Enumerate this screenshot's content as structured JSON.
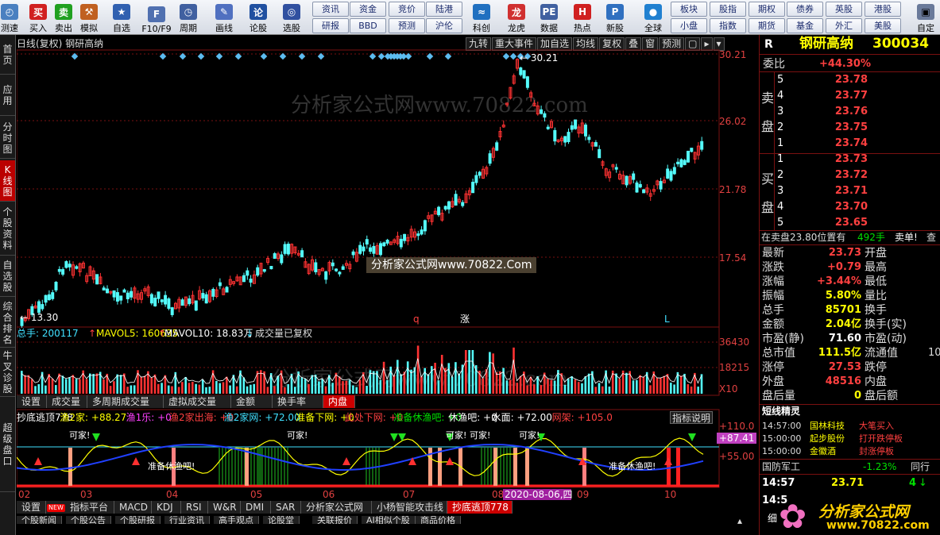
{
  "toolbar": {
    "left": [
      {
        "label": "测速",
        "icon": "speed-icon"
      },
      {
        "label": "买入",
        "icon": "buy-icon"
      },
      {
        "label": "卖出",
        "icon": "sell-icon"
      },
      {
        "label": "模拟",
        "icon": "simulate-icon"
      },
      {
        "label": "自选",
        "icon": "watchlist-icon"
      },
      {
        "label": "F10/F9",
        "icon": "f10-icon"
      },
      {
        "label": "周期",
        "icon": "clock-icon"
      },
      {
        "label": "画线",
        "icon": "pen-icon"
      },
      {
        "label": "论股",
        "icon": "forum-icon"
      },
      {
        "label": "选股",
        "icon": "select-icon"
      }
    ],
    "small": [
      [
        "资讯",
        "研报"
      ],
      [
        "资金",
        "BBD"
      ],
      [
        "竞价",
        "预测"
      ],
      [
        "陆港",
        "沪伦"
      ]
    ],
    "right": [
      {
        "label": "科创",
        "icon": "sci-icon"
      },
      {
        "label": "龙虎",
        "icon": "dragon-icon"
      },
      {
        "label": "数据",
        "icon": "data-icon"
      },
      {
        "label": "热点",
        "icon": "hot-icon"
      },
      {
        "label": "新股",
        "icon": "ipo-icon"
      },
      {
        "label": "全球",
        "icon": "globe-icon"
      }
    ],
    "small2": [
      [
        "板块",
        "小盘"
      ],
      [
        "股指",
        "指数"
      ],
      [
        "期权",
        "期货"
      ],
      [
        "债券",
        "基金"
      ],
      [
        "英股",
        "外汇"
      ],
      [
        "港股",
        "美股"
      ]
    ],
    "custom": "自定"
  },
  "sidebar": [
    "首页",
    "应用",
    "分时图",
    "K线图",
    "个股资料",
    "自选股",
    "综合排名",
    "牛叉诊股",
    "超级盘口"
  ],
  "chart": {
    "title": "日线(复权) 钢研高纳",
    "buttons": [
      "九转",
      "重大事件",
      "加自选",
      "均线",
      "复权",
      "叠",
      "窗",
      "预测"
    ],
    "price_axis": [
      "30.21",
      "26.02",
      "21.78",
      "17.54"
    ],
    "high_label": "30.21",
    "low_label": "13.30",
    "watermark": "分析家公式网www.70822.com",
    "watermark2": "分析家公式网www.70822.Com",
    "markers": [
      "q",
      "涨",
      "L"
    ],
    "vol_header": {
      "total": "总手: 200117",
      "ma5": "MAVOL5: 160635",
      "ma10": "MAVOL10: 18.83万",
      "note": "成交量已复权"
    },
    "vol_axis": [
      "36430",
      "18215",
      "X10"
    ],
    "vol_tabs": [
      "设置",
      "成交量",
      "多周期成交量",
      "虚拟成交量",
      "金额",
      "换手率",
      "内盘"
    ],
    "ind_header": [
      [
        "抄底逃顶778",
        "wht"
      ],
      [
        "渔2家: +88.27",
        "yel"
      ],
      [
        "渔1乐: +0",
        "mag"
      ],
      [
        "渔2家出海: +0",
        "red"
      ],
      [
        "渔2家网: +72.00",
        "cyn"
      ],
      [
        "准备下网: +0",
        "yel"
      ],
      [
        "此处下网: +0",
        "red"
      ],
      [
        "准备休渔吧: +0",
        "grn"
      ],
      [
        "休渔吧: +0",
        "wht"
      ],
      [
        "水面: +72.00",
        "wht"
      ],
      [
        "网架: +105.0",
        "red"
      ]
    ],
    "ind_help": "指标说明",
    "ind_axis": [
      "+110.0",
      "+87.41",
      "+55.00"
    ],
    "ind_texts": [
      "可家!",
      "可家!",
      "可家!",
      "可家!",
      "可家!",
      "准备休渔吧!",
      "准备休渔吧!"
    ],
    "date_axis": [
      "02",
      "03",
      "04",
      "05",
      "06",
      "07",
      "08",
      "2020-08-06,四",
      "09",
      "10"
    ],
    "bottom_tabs": [
      "设置",
      "指标平台",
      "MACD",
      "KDJ",
      "RSI",
      "W&R",
      "DMI",
      "SAR",
      "分析家公式网",
      "小杨智能攻击线",
      "抄底逃顶778"
    ],
    "new_badge": "NEW",
    "bottom_tabs2": [
      "个股新闻",
      "个股公告",
      "个股研报",
      "行业资讯",
      "高手观点",
      "论股堂",
      "关联报价",
      "AI相似个股",
      "商品价格"
    ]
  },
  "quote": {
    "R": "R",
    "name": "钢研高纳",
    "code": "300034",
    "weibi_label": "委比",
    "weibi": "+44.30%",
    "sell_label": "卖盘",
    "buy_label": "买盘",
    "sell": [
      [
        "5",
        "23.78"
      ],
      [
        "4",
        "23.77"
      ],
      [
        "3",
        "23.76"
      ],
      [
        "2",
        "23.75"
      ],
      [
        "1",
        "23.74"
      ]
    ],
    "buy": [
      [
        "1",
        "23.73"
      ],
      [
        "2",
        "23.72"
      ],
      [
        "3",
        "23.71"
      ],
      [
        "4",
        "23.70"
      ],
      [
        "5",
        "23.65"
      ]
    ],
    "sell_line": "在卖盘23.80位置有",
    "sell_line_amt": "492手",
    "sell_line_tag": "卖单!",
    "sell_line_more": "查",
    "stats": [
      [
        "最新",
        "23.73",
        "red",
        "开盘",
        ""
      ],
      [
        "涨跌",
        "+0.79",
        "red",
        "最高",
        ""
      ],
      [
        "涨幅",
        "+3.44%",
        "red",
        "最低",
        ""
      ],
      [
        "振幅",
        "5.80%",
        "yel",
        "量比",
        ""
      ],
      [
        "总手",
        "85701",
        "yel",
        "换手",
        ""
      ],
      [
        "金额",
        "2.04亿",
        "yel",
        "换手(实)",
        ""
      ],
      [
        "市盈(静)",
        "71.60",
        "wht",
        "市盈(动)",
        ""
      ],
      [
        "总市值",
        "111.5亿",
        "yel",
        "流通值",
        "10"
      ],
      [
        "涨停",
        "27.53",
        "red",
        "跌停",
        ""
      ],
      [
        "外盘",
        "48516",
        "red",
        "内盘",
        ""
      ],
      [
        "盘后量",
        "0",
        "yel",
        "盘后额",
        ""
      ]
    ],
    "elf_title": "短线精灵",
    "elf": [
      [
        "14:57:00",
        "国林科技",
        "大笔买入"
      ],
      [
        "15:00:00",
        "起步股份",
        "打开跌停板"
      ],
      [
        "15:00:00",
        "金徽酒",
        "封涨停板"
      ]
    ],
    "sector": "国防军工",
    "sector_chg": "-1.23%",
    "peer": "同行",
    "tick_time": "14:57",
    "tick_price": "23.71",
    "tick_vol": "4",
    "tick_time2": "14:5",
    "detail": "细"
  },
  "logo": {
    "text": "分析家公式网",
    "url": "www.70822.com"
  },
  "colors": {
    "up": "#ff3232",
    "down": "#54fcfc",
    "price_text": "#ffff00"
  }
}
